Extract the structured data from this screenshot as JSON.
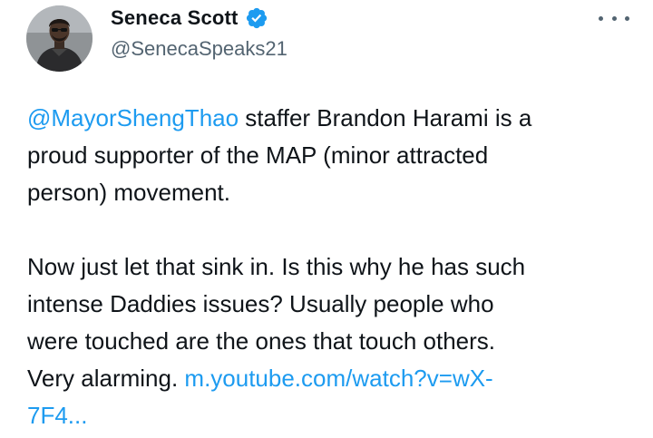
{
  "author": {
    "display_name": "Seneca Scott",
    "handle": "@SenecaSpeaks21",
    "avatar_icon": "avatar",
    "verified_icon": "verified-badge-icon"
  },
  "more_icon": "more-options-icon",
  "tweet": {
    "mention": "@MayorShengThao",
    "line1_rest": " staffer Brandon Harami is a",
    "line2": "proud supporter of the MAP (minor attracted",
    "line3": "person) movement.",
    "line4": "Now just let that sink in.  Is this why he has such",
    "line5": "intense Daddies issues?  Usually people who",
    "line6": "were touched are the ones that touch others.",
    "line7_text": "Very alarming. ",
    "link_part1": "m.youtube.com/watch?v=wX-",
    "link_part2": "7F4..."
  },
  "colors": {
    "link": "#1d9bf0",
    "verified": "#1d9bf0",
    "text": "#0f1419",
    "secondary": "#536471"
  }
}
